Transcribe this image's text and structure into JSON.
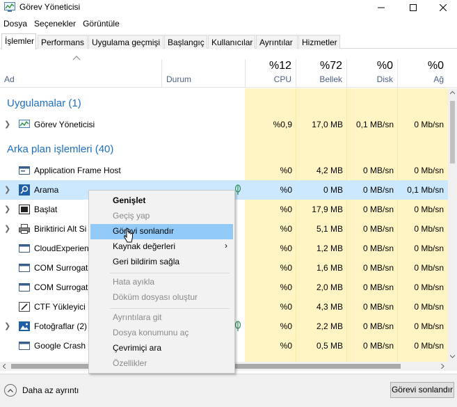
{
  "window": {
    "title": "Görev Yöneticisi"
  },
  "menu": [
    "Dosya",
    "Seçenekler",
    "Görüntüle"
  ],
  "tabs": [
    "İşlemler",
    "Performans",
    "Uygulama geçmişi",
    "Başlangıç",
    "Kullanıcılar",
    "Ayrıntılar",
    "Hizmetler"
  ],
  "header": {
    "name": "Ad",
    "status": "Durum",
    "cpu_pct": "%12",
    "cpu_label": "CPU",
    "mem_pct": "%72",
    "mem_label": "Bellek",
    "disk_pct": "%0",
    "disk_label": "Disk",
    "net_pct": "%0",
    "net_label": "Ağ"
  },
  "groups": {
    "apps": "Uygulamalar (1)",
    "background": "Arka plan işlemleri (40)"
  },
  "rows": [
    {
      "name": "Görev Yöneticisi",
      "cpu": "%0,9",
      "mem": "17,0 MB",
      "disk": "0,1 MB/sn",
      "net": "0 Mb/sn"
    },
    {
      "name": "Application Frame Host",
      "cpu": "%0",
      "mem": "4,2 MB",
      "disk": "0 MB/sn",
      "net": "0 Mb/sn"
    },
    {
      "name": "Arama",
      "cpu": "%0",
      "mem": "0 MB",
      "disk": "0 MB/sn",
      "net": "0,1 Mb/sn"
    },
    {
      "name": "Başlat",
      "cpu": "%0",
      "mem": "17,9 MB",
      "disk": "0 MB/sn",
      "net": "0 Mb/sn"
    },
    {
      "name": "Biriktirici Alt Si",
      "cpu": "%0",
      "mem": "5,1 MB",
      "disk": "0 MB/sn",
      "net": "0 Mb/sn"
    },
    {
      "name": "CloudExperien",
      "cpu": "%0",
      "mem": "1,2 MB",
      "disk": "0 MB/sn",
      "net": "0 Mb/sn"
    },
    {
      "name": "COM Surrogat",
      "cpu": "%0",
      "mem": "1,6 MB",
      "disk": "0 MB/sn",
      "net": "0 Mb/sn"
    },
    {
      "name": "COM Surrogat",
      "cpu": "%0",
      "mem": "2,0 MB",
      "disk": "0 MB/sn",
      "net": "0 Mb/sn"
    },
    {
      "name": "CTF Yükleyici",
      "cpu": "%0",
      "mem": "4,3 MB",
      "disk": "0 MB/sn",
      "net": "0 Mb/sn"
    },
    {
      "name": "Fotoğraflar (2)",
      "cpu": "%0",
      "mem": "2,2 MB",
      "disk": "0 MB/sn",
      "net": "0 Mb/sn"
    },
    {
      "name": "Google Crash H",
      "cpu": "%0",
      "mem": "0,5 MB",
      "disk": "0 MB/sn",
      "net": "0 Mb/sn"
    }
  ],
  "context_menu": {
    "expand": "Genişlet",
    "switch_to": "Geçiş yap",
    "end_task": "Görevi sonlandır",
    "resource_values": "Kaynak değerleri",
    "feedback": "Geri bildirim sağla",
    "debug": "Hata ayıkla",
    "dump": "Döküm dosyası oluştur",
    "details": "Ayrıntılara git",
    "open_location": "Dosya konumunu aç",
    "search_online": "Çevrimiçi ara",
    "properties": "Özellikler"
  },
  "footer": {
    "less_details": "Daha az ayrıntı",
    "end_task_button": "Görevi sonlandır"
  },
  "colors": {
    "group_text": "#1e70c3",
    "column_highlight": "#fff4c4",
    "selected_row": "#cce8ff",
    "menu_hover": "#91c9f7"
  }
}
